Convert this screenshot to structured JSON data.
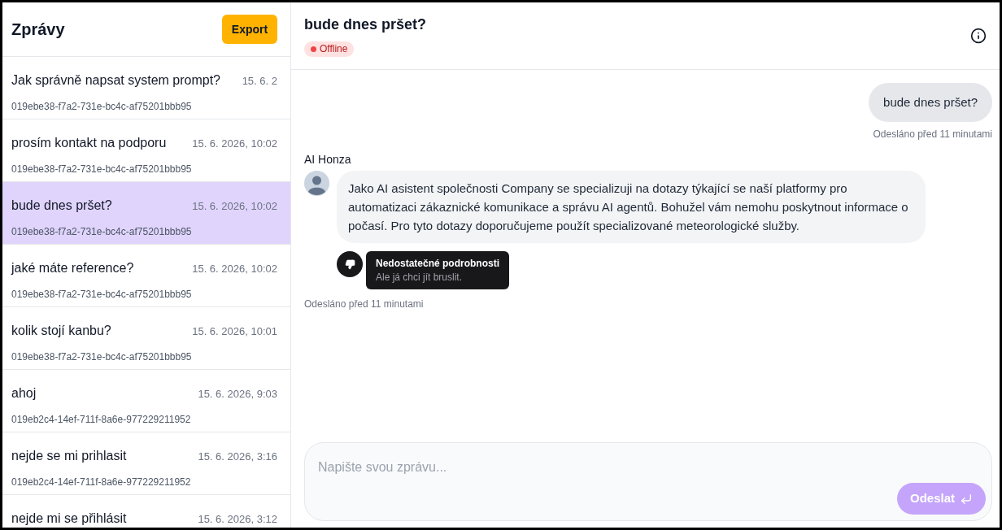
{
  "sidebar": {
    "title": "Zprávy",
    "export_button": "Export",
    "conversations": [
      {
        "title": "Jak správně napsat system prompt?",
        "time": "15. 6. 2",
        "id": "019ebe38-f7a2-731e-bc4c-af75201bbb95",
        "selected": false
      },
      {
        "title": "prosím kontakt na podporu",
        "time": "15. 6. 2026, 10:02",
        "id": "019ebe38-f7a2-731e-bc4c-af75201bbb95",
        "selected": false
      },
      {
        "title": "bude dnes pršet?",
        "time": "15. 6. 2026, 10:02",
        "id": "019ebe38-f7a2-731e-bc4c-af75201bbb95",
        "selected": true
      },
      {
        "title": "jaké máte reference?",
        "time": "15. 6. 2026, 10:02",
        "id": "019ebe38-f7a2-731e-bc4c-af75201bbb95",
        "selected": false
      },
      {
        "title": "kolik stojí kanbu?",
        "time": "15. 6. 2026, 10:01",
        "id": "019ebe38-f7a2-731e-bc4c-af75201bbb95",
        "selected": false
      },
      {
        "title": "ahoj",
        "time": "15. 6. 2026, 9:03",
        "id": "019eb2c4-14ef-711f-8a6e-977229211952",
        "selected": false
      },
      {
        "title": "nejde se mi prihlasit",
        "time": "15. 6. 2026, 3:16",
        "id": "019eb2c4-14ef-711f-8a6e-977229211952",
        "selected": false
      },
      {
        "title": "nejde mi se přihlásit",
        "time": "15. 6. 2026, 3:12",
        "selected": false
      }
    ]
  },
  "chat": {
    "title": "bude dnes pršet?",
    "status": {
      "label": "Offline",
      "online": false
    },
    "messages": [
      {
        "kind": "user",
        "text": "bude dnes pršet?",
        "meta": "Odesláno před 11 minutami"
      },
      {
        "kind": "assistant",
        "sender": "AI Honza",
        "text": "Jako AI asistent společnosti Company se specializuji na dotazy týkající se naší platformy pro automatizaci zákaznické komunikace a správu AI agentů. Bohužel vám nemohu poskytnout informace o počasí. Pro tyto dotazy doporučujeme použít specializované meteorologické služby.",
        "feedback": {
          "negative": true,
          "label": "Nedostatečné podrobnosti",
          "comment": "Ale já chci jít bruslit."
        },
        "meta": "Odesláno před 11 minutami"
      }
    ],
    "composer": {
      "placeholder": "Napište svou zprávu...",
      "send_button": "Odeslat",
      "send_disabled": true
    }
  }
}
